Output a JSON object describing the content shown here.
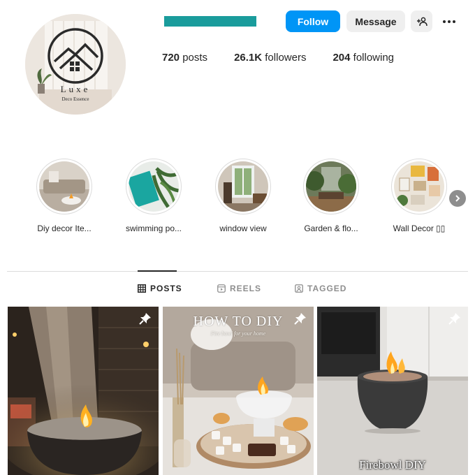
{
  "profile": {
    "logo_text": "Luxe",
    "logo_subtext": "Deco Essence",
    "buttons": {
      "follow": "Follow",
      "message": "Message"
    },
    "stats": {
      "posts_count": "720",
      "posts_label": "posts",
      "followers_count": "26.1K",
      "followers_label": "followers",
      "following_count": "204",
      "following_label": "following"
    }
  },
  "highlights": [
    {
      "label": "Diy decor Ite..."
    },
    {
      "label": "swimming po..."
    },
    {
      "label": "window view"
    },
    {
      "label": "Garden & flo..."
    },
    {
      "label": "Wall Decor ▯▯"
    }
  ],
  "tabs": [
    {
      "label": "POSTS",
      "active": true
    },
    {
      "label": "REELS",
      "active": false
    },
    {
      "label": "TAGGED",
      "active": false
    }
  ],
  "posts": [
    {
      "overlay": ""
    },
    {
      "overlay_title": "HOW TO DIY",
      "overlay_sub": "Fire bowl for your home"
    },
    {
      "caption": "Firebowl DIY"
    }
  ],
  "colors": {
    "follow_button": "#0095f6",
    "username_redaction": "#1a9c9c",
    "secondary_button": "#efefef"
  }
}
